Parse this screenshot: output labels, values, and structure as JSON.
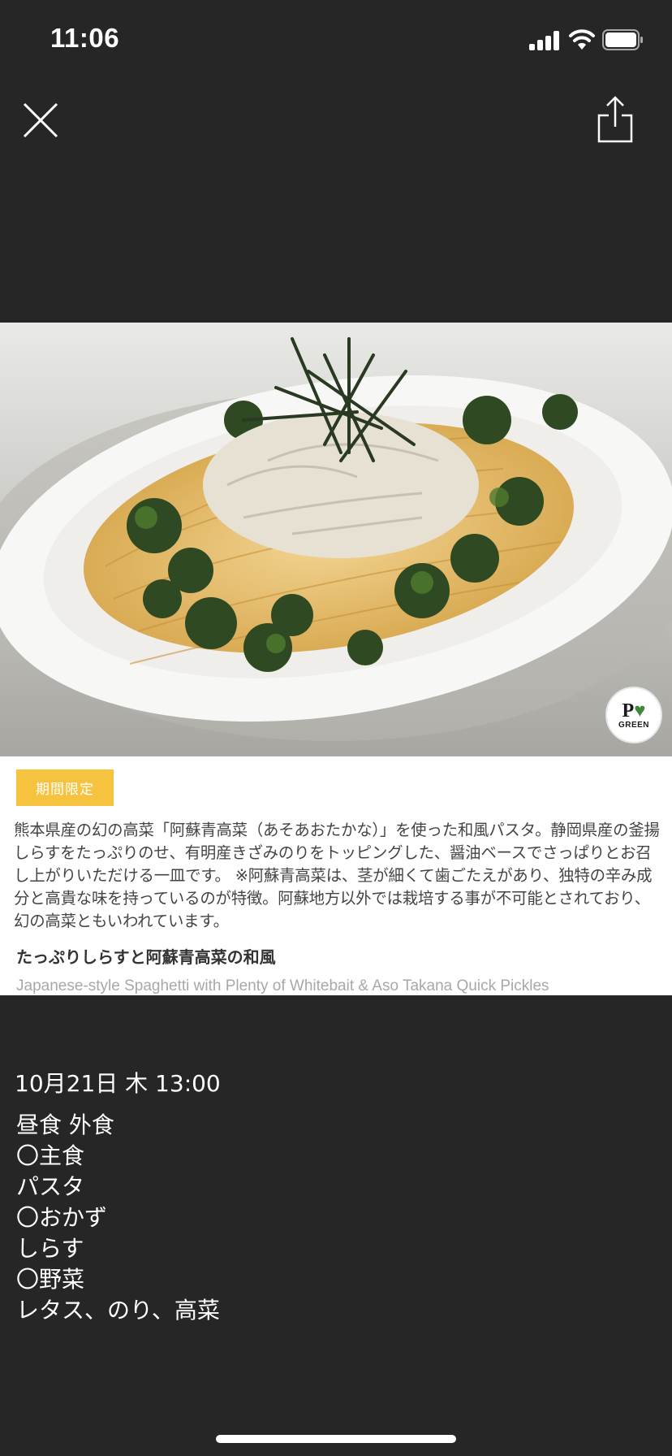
{
  "status_bar": {
    "time": "11:06"
  },
  "post": {
    "limited_tag": "期間限定",
    "description": "熊本県産の幻の高菜「阿蘇青高菜（あそあおたかな）」を使った和風パスタ。静岡県産の釜揚しらすをたっぷりのせ、有明産きざみのりをトッピングした、醤油ベースでさっぱりとお召し上がりいただける一皿です。 ※阿蘇青高菜は、茎が細くて歯ごたえがあり、独特の辛み成分と高貴な味を持っているのが特徴。阿蘇地方以外では栽培する事が不可能とされており、幻の高菜ともいわれています。",
    "menu_name_jp": "たっぷりしらすと阿蘇青高菜の和風",
    "menu_name_en": "Japanese-style Spaghetti with Plenty of Whitebait & Aso Takana Quick Pickles",
    "badge_brand": "P",
    "badge_label": "GREEN",
    "date": "10月21日 木 13:00",
    "lines": [
      "昼食 外食",
      "〇主食",
      "パスタ",
      "〇おかず",
      "しらす",
      "〇野菜",
      "レタス、のり、高菜"
    ]
  },
  "icons": {
    "close": "close-icon",
    "share": "share-icon",
    "signal": "cellular-signal-icon",
    "wifi": "wifi-icon",
    "battery": "battery-icon"
  },
  "colors": {
    "background": "#262626",
    "tag": "#f6c33f",
    "leaf": "#3f8a3a"
  }
}
